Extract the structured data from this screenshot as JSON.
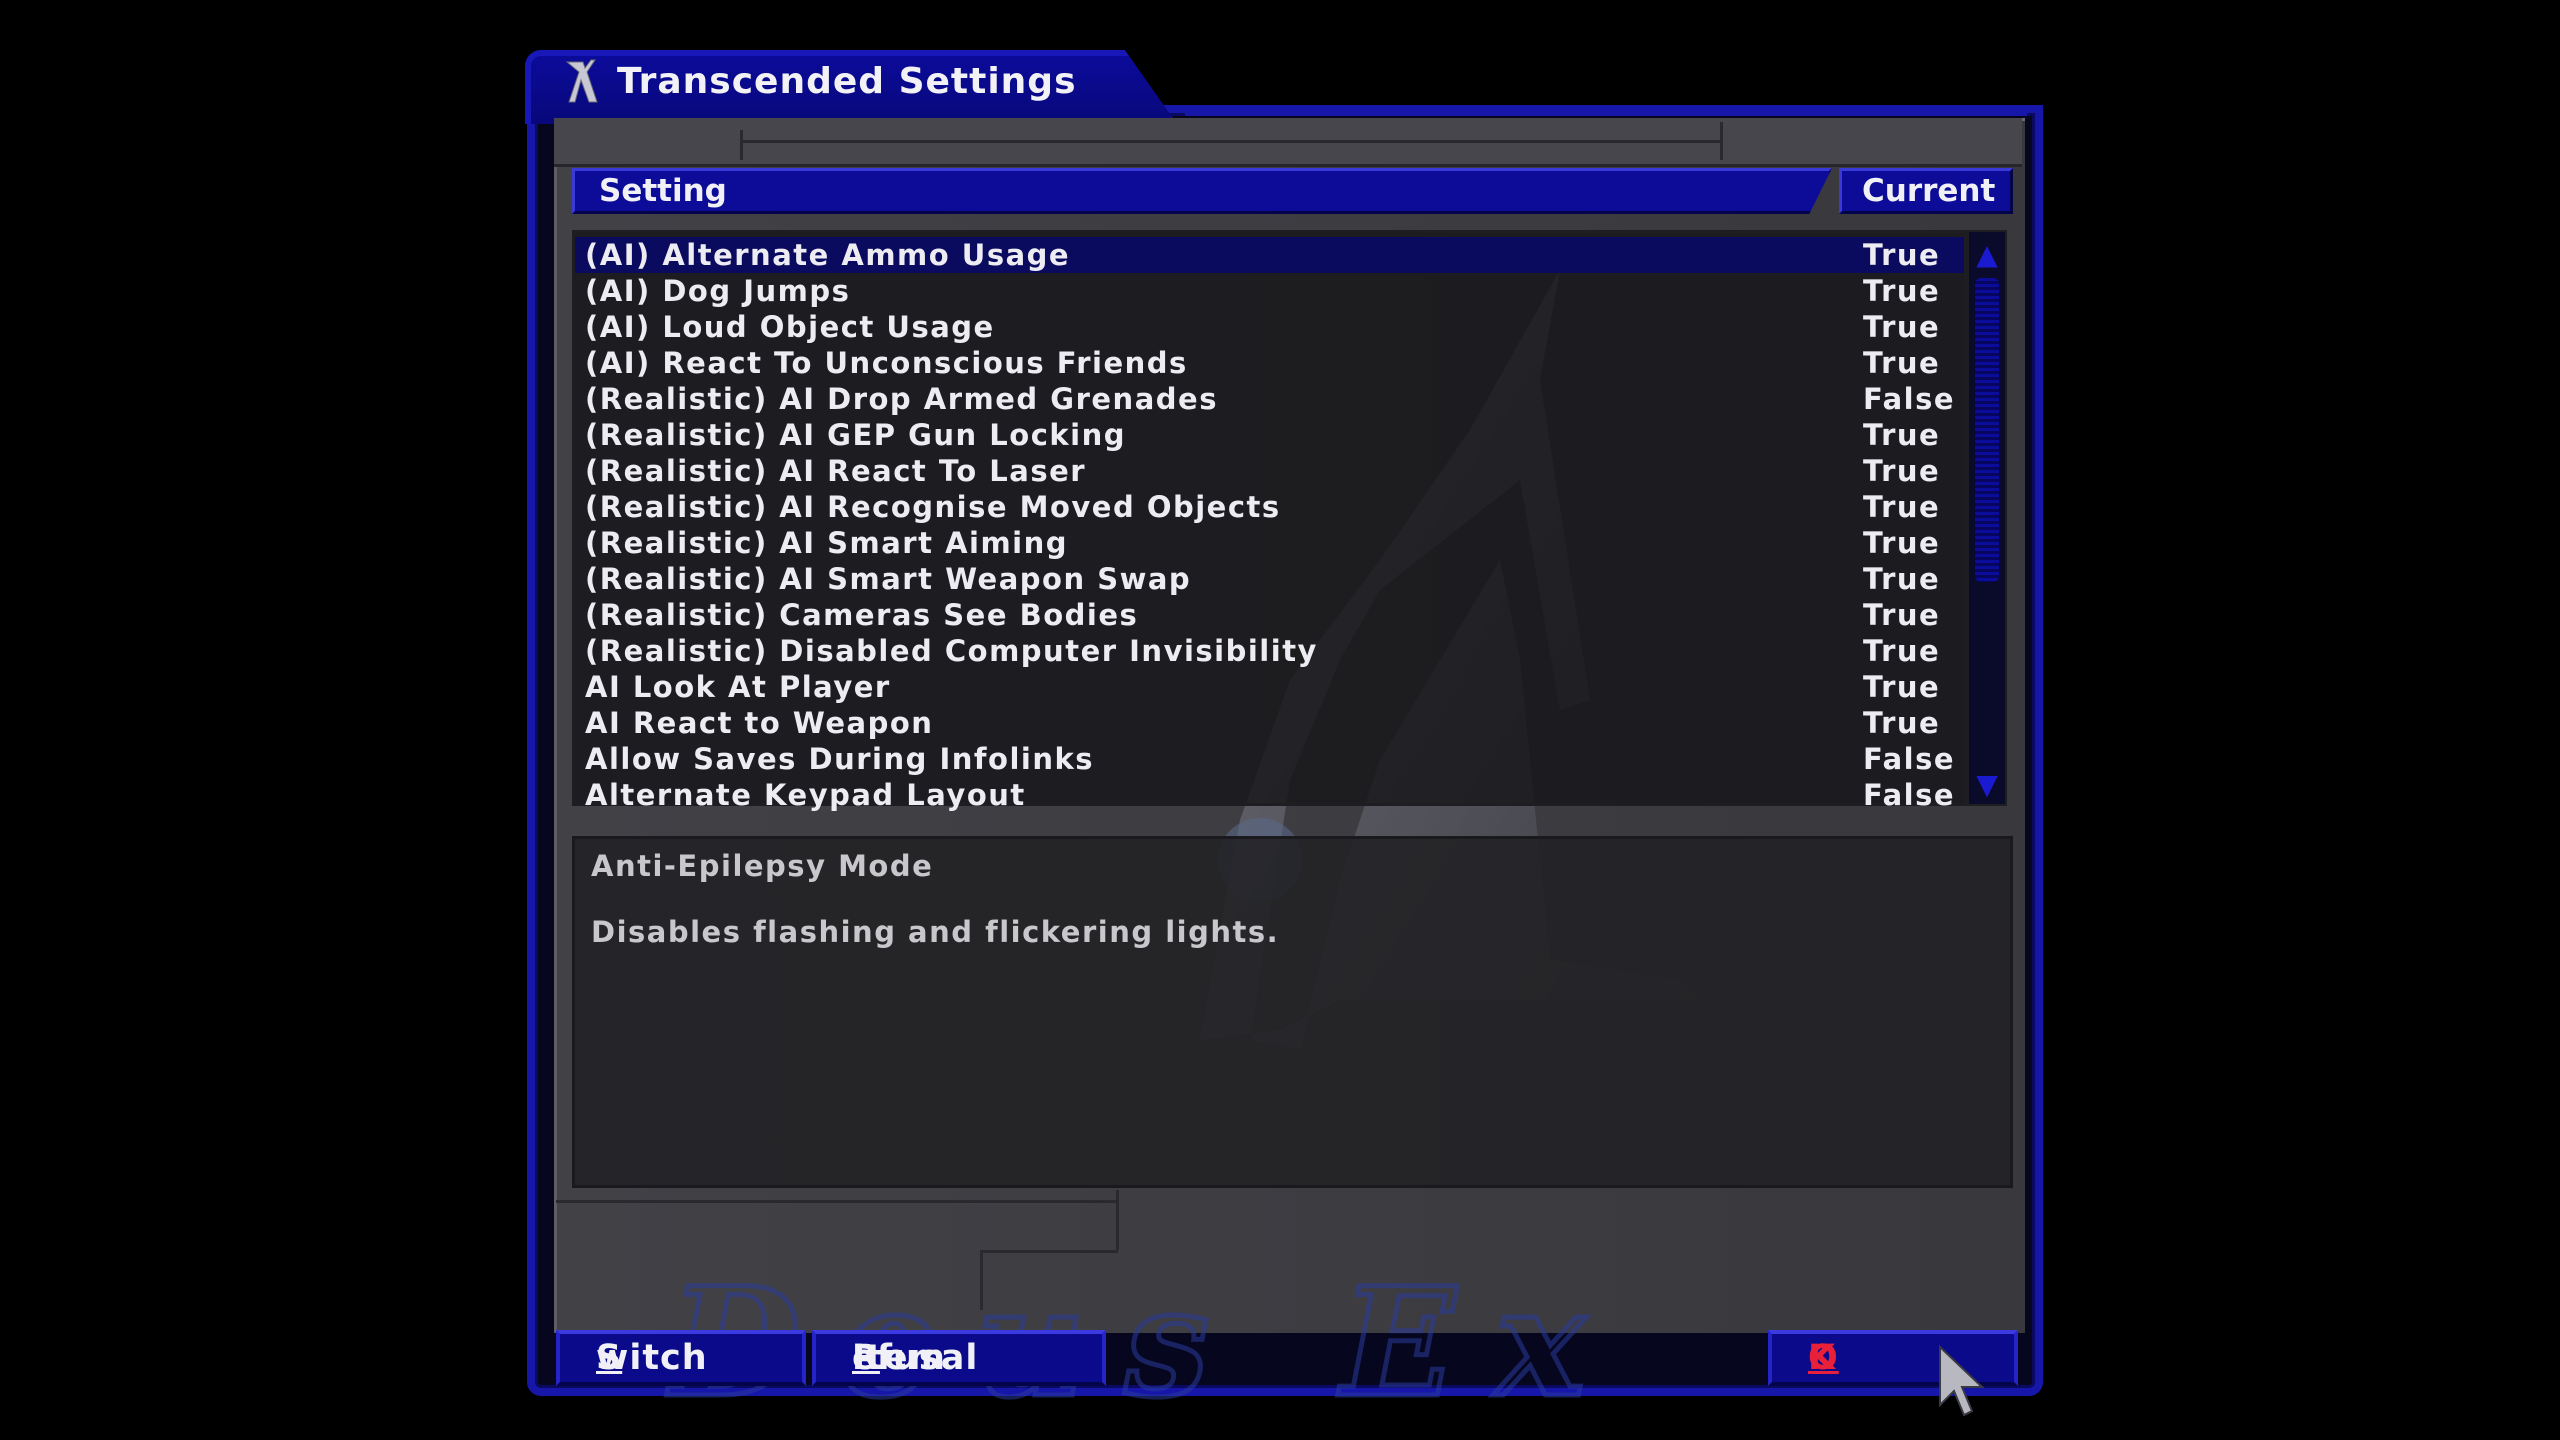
{
  "window": {
    "title": "Transcended Settings",
    "title_icon": "deus-ex-logo-icon"
  },
  "table": {
    "col_setting": "Setting",
    "col_current": "Current",
    "rows": [
      {
        "name": "(AI) Alternate Ammo Usage",
        "value": "True"
      },
      {
        "name": "(AI) Dog Jumps",
        "value": "True"
      },
      {
        "name": "(AI) Loud Object Usage",
        "value": "True"
      },
      {
        "name": "(AI) React To Unconscious Friends",
        "value": "True"
      },
      {
        "name": "(Realistic) AI Drop Armed Grenades",
        "value": "False"
      },
      {
        "name": "(Realistic) AI GEP Gun Locking",
        "value": "True"
      },
      {
        "name": "(Realistic) AI React To Laser",
        "value": "True"
      },
      {
        "name": "(Realistic) AI Recognise Moved Objects",
        "value": "True"
      },
      {
        "name": "(Realistic) AI Smart Aiming",
        "value": "True"
      },
      {
        "name": "(Realistic) AI Smart Weapon Swap",
        "value": "True"
      },
      {
        "name": "(Realistic) Cameras See Bodies",
        "value": "True"
      },
      {
        "name": "(Realistic) Disabled Computer Invisibility",
        "value": "True"
      },
      {
        "name": "AI Look At Player",
        "value": "True"
      },
      {
        "name": "AI React to Weapon",
        "value": "True"
      },
      {
        "name": "Allow Saves During Infolinks",
        "value": "False"
      },
      {
        "name": "Alternate Keypad Layout",
        "value": "False"
      }
    ],
    "selected_index": 0
  },
  "description": {
    "title": "Anti-Epilepsy Mode",
    "text": "Disables flashing and flickering lights."
  },
  "buttons": {
    "switch_first": "S",
    "switch_rest": "witch",
    "refusal_a": "Item ",
    "refusal_ul": "R",
    "refusal_rest": "efusal",
    "ok_ul": "O",
    "ok_rest": "K"
  },
  "colors": {
    "frame_blue": "#1616a8",
    "header_blue": "#0c0c98",
    "ok_red": "#e8203a"
  },
  "logo_text": "Deus Ex"
}
